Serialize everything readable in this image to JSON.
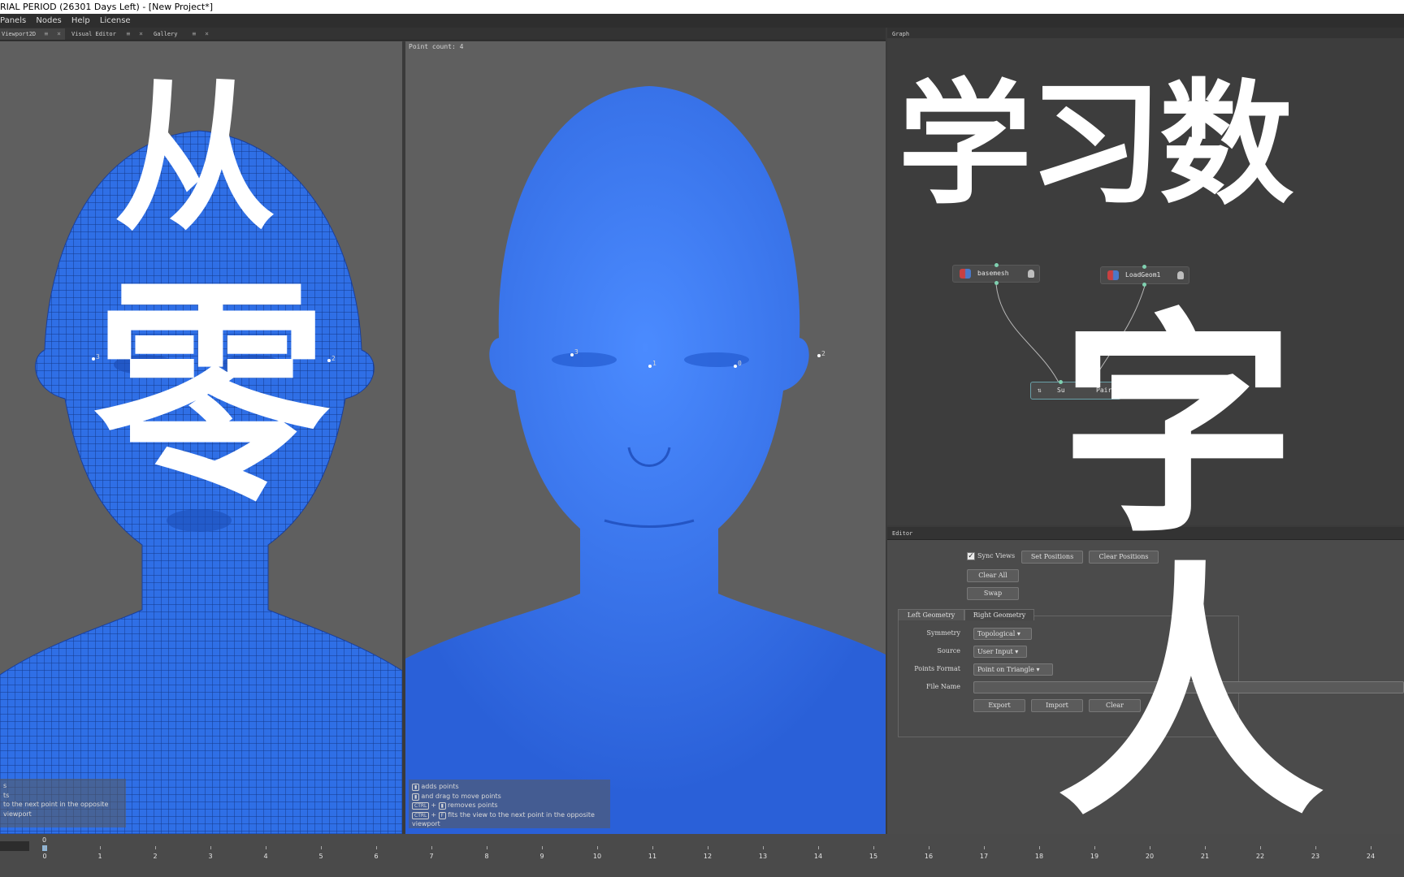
{
  "title": "RIAL PERIOD (26301 Days Left) - [New Project*]",
  "menu": [
    "Panels",
    "Nodes",
    "Help",
    "License"
  ],
  "left_tabs": [
    {
      "label": "Viewport2D",
      "ctrl": "≡ ×"
    },
    {
      "label": "Visual Editor",
      "ctrl": "≡ ×"
    },
    {
      "label": "Gallery",
      "ctrl": "≡ ×"
    }
  ],
  "graph_tab": "Graph",
  "viewport": {
    "point_count": "Point count: 4",
    "left_points": [
      "3",
      "1",
      "0",
      "2"
    ],
    "right_points": [
      "3",
      "1",
      "0",
      "2"
    ],
    "left_hints": [
      "s",
      "ts",
      "to the next point in the opposite viewport"
    ],
    "right_hints": {
      "adds": "adds points",
      "drag": "and drag to move points",
      "ctrl1": "CTRL",
      "remove": "removes points",
      "ctrl2": "CTRL",
      "fit": "fits the view to the next point in the opposite viewport"
    }
  },
  "overlay": {
    "left": [
      "从",
      "零"
    ],
    "right_top": "学习数",
    "right_bottom": [
      "字",
      "人"
    ]
  },
  "graph": {
    "nodes": [
      {
        "label": "basemesh"
      },
      {
        "label": "LoadGeom1"
      },
      {
        "label_left": "Su",
        "label_right": "Pairs"
      }
    ]
  },
  "editor": {
    "header": "Editor",
    "sync_views": "Sync Views",
    "set_positions": "Set Positions",
    "clear_positions": "Clear Positions",
    "clear_all": "Clear All",
    "swap": "Swap",
    "tabs": [
      "Left Geometry",
      "Right Geometry"
    ],
    "fields": {
      "symmetry_label": "Symmetry",
      "symmetry_value": "Topological",
      "source_label": "Source",
      "source_value": "User Input",
      "points_format_label": "Points Format",
      "points_format_value": "Point on Triangle",
      "file_name_label": "File Name",
      "file_name_value": ""
    },
    "export": "Export",
    "import": "Import",
    "clear": "Clear"
  },
  "timeline": {
    "current_frame": "0",
    "ticks": [
      "0",
      "1",
      "2",
      "3",
      "4",
      "5",
      "6",
      "7",
      "8",
      "9",
      "10",
      "11",
      "12",
      "13",
      "14",
      "15",
      "16",
      "17",
      "18",
      "19",
      "20",
      "21",
      "22",
      "23",
      "24"
    ]
  },
  "colors": {
    "mesh_blue": "#2f6fe6",
    "panel_bg": "#5f5f5f",
    "graph_bg": "#3d3d3d",
    "editor_bg": "#4b4b4b"
  }
}
